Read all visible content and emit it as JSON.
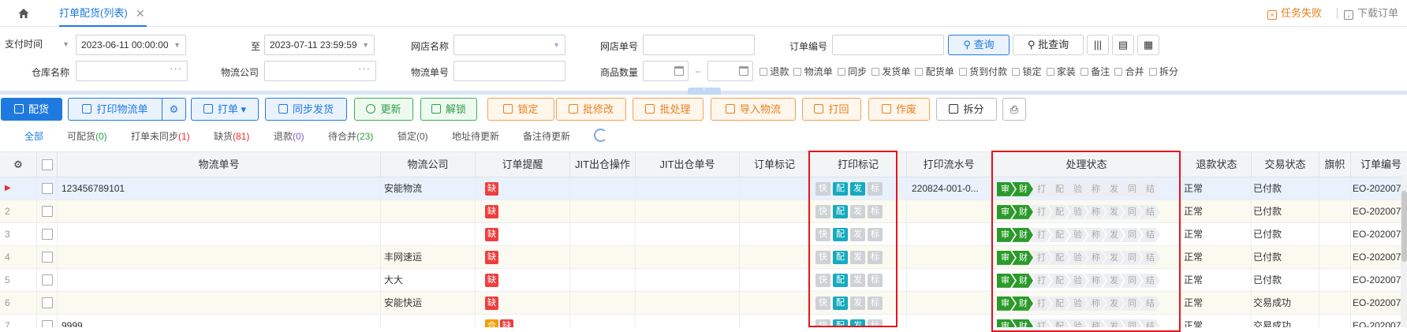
{
  "header": {
    "page_tab": "打单配货(列表)",
    "task_fail": "任务失败",
    "download_orders": "下载订单"
  },
  "filters": {
    "time_type": "支付时间",
    "start_time": "2023-06-11 00:00:00",
    "to_label": "至",
    "end_time": "2023-07-11 23:59:59",
    "shop_name_label": "网店名称",
    "shop_order_label": "网店单号",
    "order_no_label": "订单编号",
    "query_btn": "查询",
    "batch_query_btn": "批查询",
    "warehouse_label": "仓库名称",
    "logistics_company_label": "物流公司",
    "logistics_no_label": "物流单号",
    "goods_qty_label": "商品数量",
    "range_sep": "–",
    "checks": [
      "退款",
      "物流单",
      "同步",
      "发货单",
      "配货单",
      "货到付款",
      "锁定",
      "家装",
      "备注",
      "合并",
      "拆分"
    ]
  },
  "toolbar": {
    "allocate": "配货",
    "print_logistics": "打印物流单",
    "print_order": "打单",
    "sync_ship": "同步发货",
    "update": "更新",
    "unlock": "解锁",
    "lock": "锁定",
    "batch_modify": "批修改",
    "batch_process": "批处理",
    "import_logistics": "导入物流",
    "return": "打回",
    "void": "作废",
    "split": "拆分"
  },
  "quick_tabs": {
    "all": "全部",
    "allocatable": "可配货",
    "allocatable_n": "(0)",
    "unsync": "打单未同步",
    "unsync_n": "(1)",
    "shortage": "缺货",
    "shortage_n": "(81)",
    "refund": "退款",
    "refund_n": "(0)",
    "merge": "待合并",
    "merge_n": "(23)",
    "locked": "锁定",
    "locked_n": "(0)",
    "addr_update": "地址待更新",
    "note_update": "备注待更新"
  },
  "table": {
    "headers": {
      "logistics_no": "物流单号",
      "logistics_company": "物流公司",
      "order_remind": "订单提醒",
      "jit_op": "JIT出仓操作",
      "jit_no": "JIT出仓单号",
      "order_mark": "订单标记",
      "print_mark": "打印标记",
      "print_serial": "打印流水号",
      "process_status": "处理状态",
      "refund_status": "退款状态",
      "trade_status": "交易状态",
      "flag": "旗帜",
      "order_no": "订单编号"
    },
    "print_marks": [
      "快",
      "配",
      "发",
      "标"
    ],
    "steps": [
      "审",
      "财",
      "打",
      "配",
      "验",
      "称",
      "发",
      "同",
      "结"
    ],
    "tag_shortage": "缺",
    "tag_merge": "合",
    "rows": [
      {
        "n": "▶",
        "lno": "123456789101",
        "co": "安能物流",
        "merge": false,
        "pm": [
          0,
          1,
          1,
          0
        ],
        "serial": "220824-001-0...",
        "refund": "正常",
        "trade": "已付款",
        "ono": "EO-202007"
      },
      {
        "n": "2",
        "lno": "",
        "co": "",
        "merge": false,
        "pm": [
          0,
          1,
          0,
          0
        ],
        "serial": "",
        "refund": "正常",
        "trade": "已付款",
        "ono": "EO-202007"
      },
      {
        "n": "3",
        "lno": "",
        "co": "",
        "merge": false,
        "pm": [
          0,
          1,
          0,
          0
        ],
        "serial": "",
        "refund": "正常",
        "trade": "已付款",
        "ono": "EO-202007"
      },
      {
        "n": "4",
        "lno": "",
        "co": "丰网速运",
        "merge": false,
        "pm": [
          0,
          1,
          0,
          0
        ],
        "serial": "",
        "refund": "正常",
        "trade": "已付款",
        "ono": "EO-202007"
      },
      {
        "n": "5",
        "lno": "",
        "co": "大大",
        "merge": false,
        "pm": [
          0,
          1,
          0,
          0
        ],
        "serial": "",
        "refund": "正常",
        "trade": "已付款",
        "ono": "EO-202007"
      },
      {
        "n": "6",
        "lno": "",
        "co": "安能快运",
        "merge": false,
        "pm": [
          0,
          1,
          0,
          0
        ],
        "serial": "",
        "refund": "正常",
        "trade": "交易成功",
        "ono": "EO-202007"
      },
      {
        "n": "7",
        "lno": "9999",
        "co": "",
        "merge": true,
        "pm": [
          0,
          1,
          1,
          0
        ],
        "serial": "",
        "refund": "正常",
        "trade": "交易成功",
        "ono": "EO-202007"
      }
    ]
  }
}
